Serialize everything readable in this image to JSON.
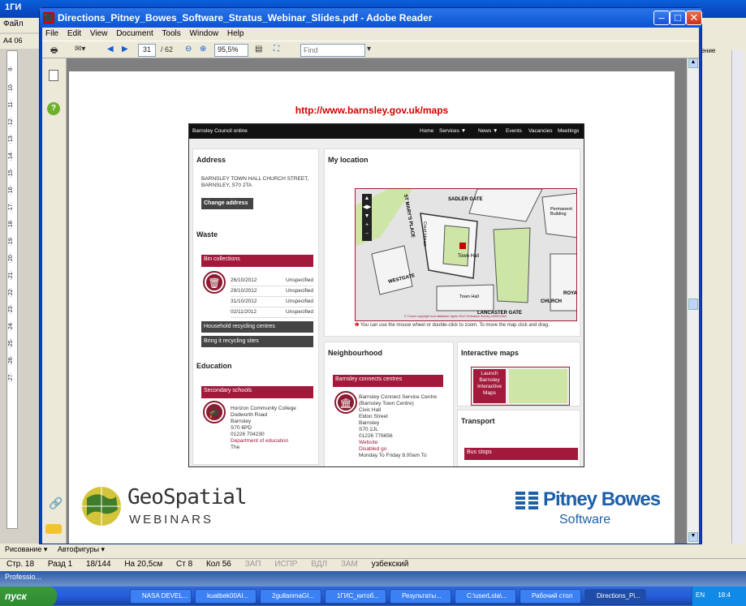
{
  "background_window": {
    "title_frag": "1ГИ",
    "menu": "Файл",
    "ruler": [
      "9",
      "10",
      "11",
      "12",
      "13",
      "14",
      "15",
      "16",
      "17",
      "18",
      "19",
      "20",
      "21",
      "22",
      "23",
      "24",
      "25",
      "26",
      "27"
    ],
    "right_label": "тение",
    "status": {
      "page": "Стр. 18",
      "section": "Разд 1",
      "pages": "18/144",
      "at": "На 20,5см",
      "line": "Ст 8",
      "col": "Кол 56",
      "rec": "ЗАП",
      "trk": "ИСПР",
      "ext": "ВДЛ",
      "ovr": "ЗАМ",
      "lang": "узбекский"
    },
    "draw_label": "Рисование ▾",
    "autoshapes": "Автофигуры ▾",
    "prof_label": "Professio..."
  },
  "adobe": {
    "title": "Directions_Pitney_Bowes_Software_Stratus_Webinar_Slides.pdf - Adobe Reader",
    "menu": [
      "File",
      "Edit",
      "View",
      "Document",
      "Tools",
      "Window",
      "Help"
    ],
    "page_current": "31",
    "page_total": "/ 62",
    "zoom": "95,5%",
    "find_placeholder": "Find"
  },
  "slide": {
    "url": "http://www.barnsley.gov.uk/maps",
    "site": {
      "brand": "Barnsley Council online",
      "nav": [
        "Home",
        "Services ▼",
        "News ▼",
        "Events",
        "Vacancies",
        "Meetings"
      ],
      "address_title": "Address",
      "address_text": "BARNSLEY TOWN HALL CHURCH STREET, BARNSLEY, S70 2TA",
      "change_address": "Change address",
      "waste_title": "Waste",
      "bin_collections": "Bin collections",
      "bins": [
        {
          "date": "26/10/2012",
          "status": "Unspecified"
        },
        {
          "date": "29/10/2012",
          "status": "Unspecified"
        },
        {
          "date": "31/10/2012",
          "status": "Unspecified"
        },
        {
          "date": "02/11/2012",
          "status": "Unspecified"
        }
      ],
      "household_recycling": "Household recycling centres",
      "bring_recycling": "Bring it recycling sites",
      "education_title": "Education",
      "secondary_schools": "Secondary schools",
      "school_lines": [
        "Horizon Community College",
        "Dodworth Road",
        "Barnsley",
        "S70 6PD",
        "01226 704230"
      ],
      "school_link": "Department of education",
      "school_more": "The",
      "location_title": "My location",
      "map_labels": [
        "SADLER GATE",
        "ST MARY'S PLACE",
        "Permanent Building",
        "Court House",
        "Town Hall",
        "WESTGATE",
        "Town Hall",
        "LANCASTER GATE",
        "CHURCH",
        "ROYA",
        "© Crown copyright and database rights 2012 Ordnance Survey 100022264"
      ],
      "map_hint": "You can use the mouse wheel or double-click to zoom. To move the map click and drag.",
      "neighbourhood_title": "Neighbourhood",
      "connects": "Barnsley connects centres",
      "connect_lines": [
        "Barnsley Connect Service Centre",
        "(Barnsley Town Centre)",
        "Civic Hall",
        "Eldon Street",
        "Barnsley",
        "S70 2JL",
        "01226 776656"
      ],
      "connect_links": [
        "Website",
        "Disabled go"
      ],
      "connect_more": "Monday To Friday 8.00am To",
      "interactive_title": "Interactive maps",
      "launch": "Launch Barnsley Interactive Maps",
      "transport_title": "Transport",
      "bus_stops": "Bus stops"
    },
    "geospatial_top": "GeoSpatial",
    "geospatial_bottom": "WEBINARS",
    "pb_top": "Pitney Bowes",
    "pb_bottom": "Software"
  },
  "taskbar": {
    "start": "пуск",
    "tasks": [
      "NASA DEVEL...",
      "kuatbek00AI...",
      "2gullanmaGI...",
      "1ГИС_китоб...",
      "Результаты...",
      "C:\\userLola\\...",
      "Рабочий стол",
      "Directions_Pi..."
    ],
    "lang": "EN",
    "time": "18:4"
  }
}
